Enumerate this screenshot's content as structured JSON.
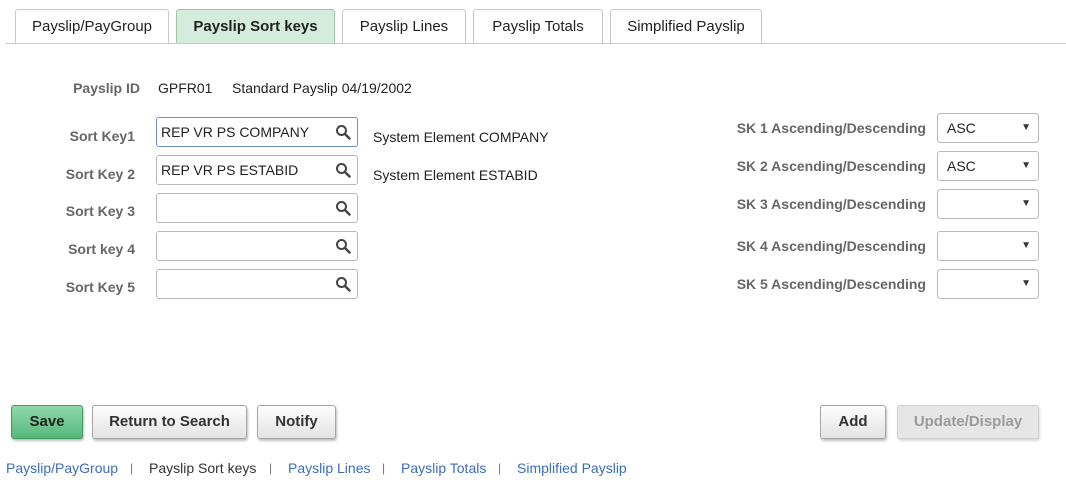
{
  "tabs": [
    {
      "label": "Payslip/PayGroup",
      "active": false
    },
    {
      "label": "Payslip Sort keys",
      "active": true
    },
    {
      "label": "Payslip Lines",
      "active": false
    },
    {
      "label": "Payslip Totals",
      "active": false
    },
    {
      "label": "Simplified Payslip",
      "active": false
    }
  ],
  "payslip": {
    "id_label": "Payslip ID",
    "id_value": "GPFR01",
    "description": "Standard Payslip 04/19/2002"
  },
  "sort_keys": [
    {
      "label": "Sort Key1",
      "value": "REP VR PS COMPANY",
      "description": "System Element COMPANY"
    },
    {
      "label": "Sort Key 2",
      "value": "REP VR PS ESTABID",
      "description": "System Element ESTABID"
    },
    {
      "label": "Sort Key 3",
      "value": "",
      "description": ""
    },
    {
      "label": "Sort key 4",
      "value": "",
      "description": ""
    },
    {
      "label": "Sort Key 5",
      "value": "",
      "description": ""
    }
  ],
  "sort_orders": [
    {
      "label": "SK 1 Ascending/Descending",
      "value": "ASC"
    },
    {
      "label": "SK 2 Ascending/Descending",
      "value": "ASC"
    },
    {
      "label": "SK 3 Ascending/Descending",
      "value": ""
    },
    {
      "label": "SK 4 Ascending/Descending",
      "value": ""
    },
    {
      "label": "SK 5 Ascending/Descending",
      "value": ""
    }
  ],
  "buttons": {
    "save": "Save",
    "return_to_search": "Return to Search",
    "notify": "Notify",
    "add": "Add",
    "update_display": "Update/Display"
  },
  "bottom_links": [
    {
      "label": "Payslip/PayGroup",
      "current": false
    },
    {
      "label": "Payslip Sort keys",
      "current": true
    },
    {
      "label": "Payslip Lines",
      "current": false
    },
    {
      "label": "Payslip Totals",
      "current": false
    },
    {
      "label": "Simplified Payslip",
      "current": false
    }
  ],
  "colors": {
    "active_tab": "#d4ecdb",
    "primary_button": "#56b87c",
    "link": "#3b6dbf"
  },
  "icons": {
    "lookup": "magnifier-icon",
    "dropdown": "chevron-down-icon"
  }
}
